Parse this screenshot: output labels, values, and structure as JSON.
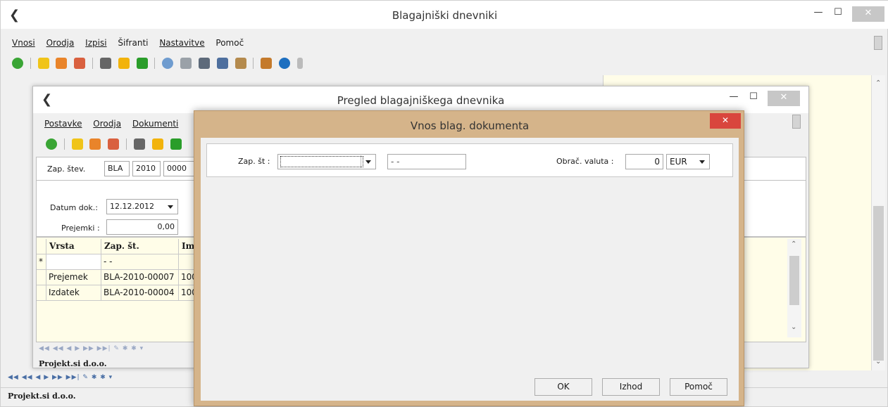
{
  "main_window": {
    "title": "Blagajniški dnevniki",
    "menu": [
      "Vnosi",
      "Orodja",
      "Izpisi",
      "Šifranti",
      "Nastavitve",
      "Pomoč"
    ],
    "status_company": "Projekt.si d.o.o.",
    "nav_glyphs": "◀◀ ◀◀ ◀ ▶ ▶▶ ▶▶| ✎ ✱ ✱ ▾"
  },
  "preview_window": {
    "title": "Pregled blagajniškega dnevnika",
    "menu": [
      "Postavke",
      "Orodja",
      "Dokumenti"
    ],
    "zap_label": "Zap. štev.",
    "zap_prefix": "BLA",
    "zap_year": "2010",
    "zap_num": "0000",
    "datum_label": "Datum dok.:",
    "datum_value": "12.12.2012",
    "prejemki_label": "Prejemki :",
    "prejemki_value": "0,00",
    "grid": {
      "headers": [
        "Vrsta",
        "Zap. št.",
        "Im"
      ],
      "new_row_marker": "*",
      "new_row_zap": " -  -",
      "rows": [
        {
          "vrsta": "Prejemek",
          "zap": "BLA-2010-00007",
          "im": "100"
        },
        {
          "vrsta": "Izdatek",
          "zap": "BLA-2010-00004",
          "im": "100"
        }
      ]
    },
    "status_company": "Projekt.si d.o.o."
  },
  "dialog": {
    "title": "Vnos blag. dokumenta",
    "zap_label": "Zap. št :",
    "zap_value": "",
    "zap_mask": " -  -",
    "valuta_label": "Obrač. valuta :",
    "valuta_amount": "0",
    "valuta_code": "EUR",
    "buttons": {
      "ok": "OK",
      "izhod": "Izhod",
      "pomoc": "Pomoč"
    },
    "close_glyph": "✕"
  },
  "colors": {
    "accent_close_red": "#d9463d",
    "dialog_frame": "#d5b48a",
    "side_panel": "#fffde8"
  }
}
